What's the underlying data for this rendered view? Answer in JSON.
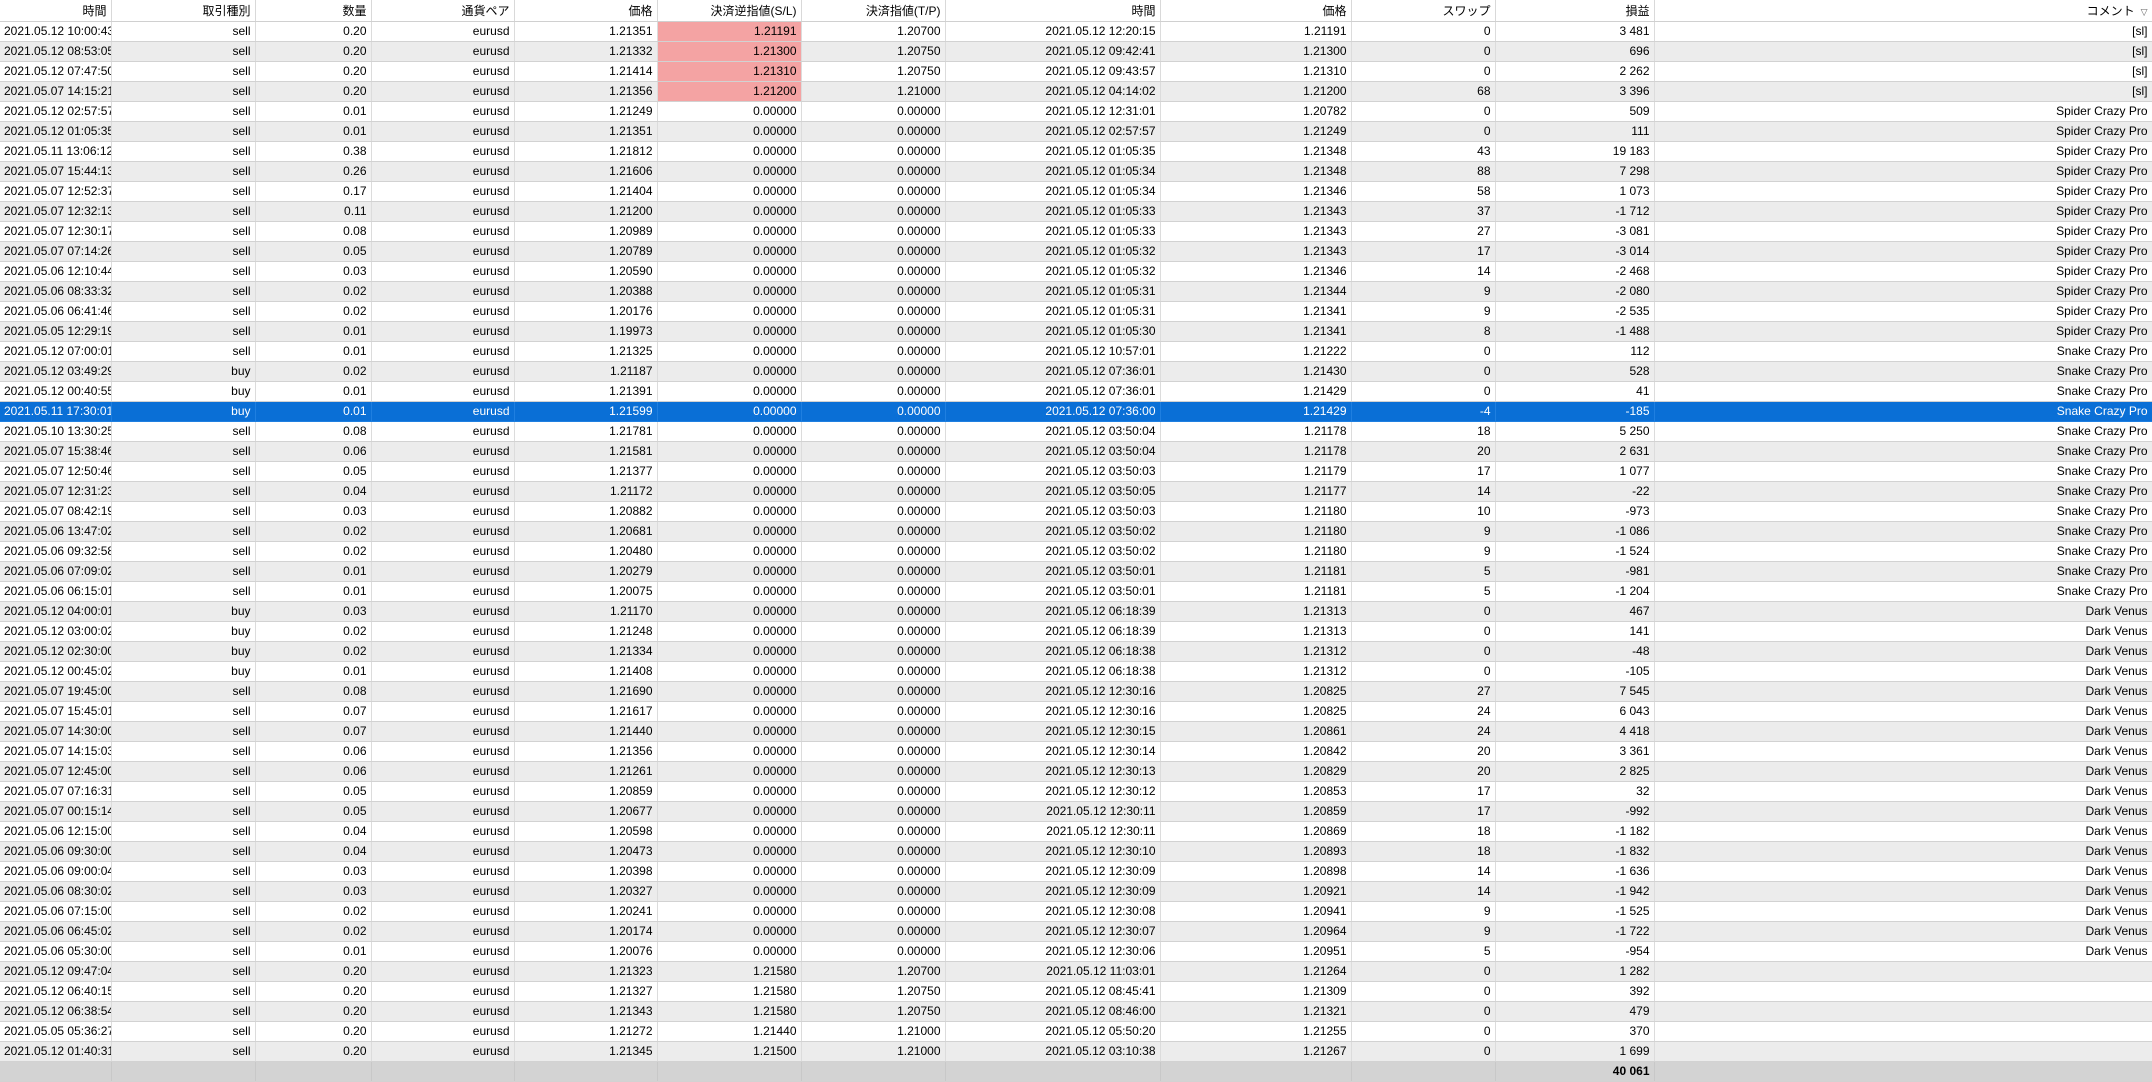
{
  "columns": [
    "時間",
    "取引種別",
    "数量",
    "通貨ペア",
    "価格",
    "決済逆指値(S/L)",
    "決済指値(T/P)",
    "時間",
    "価格",
    "スワップ",
    "損益",
    "コメント"
  ],
  "sort_icon": "▽",
  "colors": {
    "row_alt": "#ececec",
    "selected": "#0a6fd6",
    "sl_highlight": "#f4a3a3",
    "footer": "#d3d3d3"
  },
  "selected_row": 19,
  "rows": [
    [
      "2021.05.12 10:00:43",
      "sell",
      "0.20",
      "eurusd",
      "1.21351",
      "1.21191",
      "1.20700",
      "2021.05.12 12:20:15",
      "1.21191",
      "0",
      "3 481",
      "[sl]"
    ],
    [
      "2021.05.12 08:53:05",
      "sell",
      "0.20",
      "eurusd",
      "1.21332",
      "1.21300",
      "1.20750",
      "2021.05.12 09:42:41",
      "1.21300",
      "0",
      "696",
      "[sl]"
    ],
    [
      "2021.05.12 07:47:50",
      "sell",
      "0.20",
      "eurusd",
      "1.21414",
      "1.21310",
      "1.20750",
      "2021.05.12 09:43:57",
      "1.21310",
      "0",
      "2 262",
      "[sl]"
    ],
    [
      "2021.05.07 14:15:21",
      "sell",
      "0.20",
      "eurusd",
      "1.21356",
      "1.21200",
      "1.21000",
      "2021.05.12 04:14:02",
      "1.21200",
      "68",
      "3 396",
      "[sl]"
    ],
    [
      "2021.05.12 02:57:57",
      "sell",
      "0.01",
      "eurusd",
      "1.21249",
      "0.00000",
      "0.00000",
      "2021.05.12 12:31:01",
      "1.20782",
      "0",
      "509",
      "Spider Crazy Pro"
    ],
    [
      "2021.05.12 01:05:35",
      "sell",
      "0.01",
      "eurusd",
      "1.21351",
      "0.00000",
      "0.00000",
      "2021.05.12 02:57:57",
      "1.21249",
      "0",
      "111",
      "Spider Crazy Pro"
    ],
    [
      "2021.05.11 13:06:12",
      "sell",
      "0.38",
      "eurusd",
      "1.21812",
      "0.00000",
      "0.00000",
      "2021.05.12 01:05:35",
      "1.21348",
      "43",
      "19 183",
      "Spider Crazy Pro"
    ],
    [
      "2021.05.07 15:44:13",
      "sell",
      "0.26",
      "eurusd",
      "1.21606",
      "0.00000",
      "0.00000",
      "2021.05.12 01:05:34",
      "1.21348",
      "88",
      "7 298",
      "Spider Crazy Pro"
    ],
    [
      "2021.05.07 12:52:37",
      "sell",
      "0.17",
      "eurusd",
      "1.21404",
      "0.00000",
      "0.00000",
      "2021.05.12 01:05:34",
      "1.21346",
      "58",
      "1 073",
      "Spider Crazy Pro"
    ],
    [
      "2021.05.07 12:32:13",
      "sell",
      "0.11",
      "eurusd",
      "1.21200",
      "0.00000",
      "0.00000",
      "2021.05.12 01:05:33",
      "1.21343",
      "37",
      "-1 712",
      "Spider Crazy Pro"
    ],
    [
      "2021.05.07 12:30:17",
      "sell",
      "0.08",
      "eurusd",
      "1.20989",
      "0.00000",
      "0.00000",
      "2021.05.12 01:05:33",
      "1.21343",
      "27",
      "-3 081",
      "Spider Crazy Pro"
    ],
    [
      "2021.05.07 07:14:26",
      "sell",
      "0.05",
      "eurusd",
      "1.20789",
      "0.00000",
      "0.00000",
      "2021.05.12 01:05:32",
      "1.21343",
      "17",
      "-3 014",
      "Spider Crazy Pro"
    ],
    [
      "2021.05.06 12:10:44",
      "sell",
      "0.03",
      "eurusd",
      "1.20590",
      "0.00000",
      "0.00000",
      "2021.05.12 01:05:32",
      "1.21346",
      "14",
      "-2 468",
      "Spider Crazy Pro"
    ],
    [
      "2021.05.06 08:33:32",
      "sell",
      "0.02",
      "eurusd",
      "1.20388",
      "0.00000",
      "0.00000",
      "2021.05.12 01:05:31",
      "1.21344",
      "9",
      "-2 080",
      "Spider Crazy Pro"
    ],
    [
      "2021.05.06 06:41:46",
      "sell",
      "0.02",
      "eurusd",
      "1.20176",
      "0.00000",
      "0.00000",
      "2021.05.12 01:05:31",
      "1.21341",
      "9",
      "-2 535",
      "Spider Crazy Pro"
    ],
    [
      "2021.05.05 12:29:19",
      "sell",
      "0.01",
      "eurusd",
      "1.19973",
      "0.00000",
      "0.00000",
      "2021.05.12 01:05:30",
      "1.21341",
      "8",
      "-1 488",
      "Spider Crazy Pro"
    ],
    [
      "2021.05.12 07:00:01",
      "sell",
      "0.01",
      "eurusd",
      "1.21325",
      "0.00000",
      "0.00000",
      "2021.05.12 10:57:01",
      "1.21222",
      "0",
      "112",
      "Snake Crazy Pro"
    ],
    [
      "2021.05.12 03:49:29",
      "buy",
      "0.02",
      "eurusd",
      "1.21187",
      "0.00000",
      "0.00000",
      "2021.05.12 07:36:01",
      "1.21430",
      "0",
      "528",
      "Snake Crazy Pro"
    ],
    [
      "2021.05.12 00:40:55",
      "buy",
      "0.01",
      "eurusd",
      "1.21391",
      "0.00000",
      "0.00000",
      "2021.05.12 07:36:01",
      "1.21429",
      "0",
      "41",
      "Snake Crazy Pro"
    ],
    [
      "2021.05.11 17:30:01",
      "buy",
      "0.01",
      "eurusd",
      "1.21599",
      "0.00000",
      "0.00000",
      "2021.05.12 07:36:00",
      "1.21429",
      "-4",
      "-185",
      "Snake Crazy Pro"
    ],
    [
      "2021.05.10 13:30:25",
      "sell",
      "0.08",
      "eurusd",
      "1.21781",
      "0.00000",
      "0.00000",
      "2021.05.12 03:50:04",
      "1.21178",
      "18",
      "5 250",
      "Snake Crazy Pro"
    ],
    [
      "2021.05.07 15:38:46",
      "sell",
      "0.06",
      "eurusd",
      "1.21581",
      "0.00000",
      "0.00000",
      "2021.05.12 03:50:04",
      "1.21178",
      "20",
      "2 631",
      "Snake Crazy Pro"
    ],
    [
      "2021.05.07 12:50:46",
      "sell",
      "0.05",
      "eurusd",
      "1.21377",
      "0.00000",
      "0.00000",
      "2021.05.12 03:50:03",
      "1.21179",
      "17",
      "1 077",
      "Snake Crazy Pro"
    ],
    [
      "2021.05.07 12:31:23",
      "sell",
      "0.04",
      "eurusd",
      "1.21172",
      "0.00000",
      "0.00000",
      "2021.05.12 03:50:05",
      "1.21177",
      "14",
      "-22",
      "Snake Crazy Pro"
    ],
    [
      "2021.05.07 08:42:19",
      "sell",
      "0.03",
      "eurusd",
      "1.20882",
      "0.00000",
      "0.00000",
      "2021.05.12 03:50:03",
      "1.21180",
      "10",
      "-973",
      "Snake Crazy Pro"
    ],
    [
      "2021.05.06 13:47:02",
      "sell",
      "0.02",
      "eurusd",
      "1.20681",
      "0.00000",
      "0.00000",
      "2021.05.12 03:50:02",
      "1.21180",
      "9",
      "-1 086",
      "Snake Crazy Pro"
    ],
    [
      "2021.05.06 09:32:58",
      "sell",
      "0.02",
      "eurusd",
      "1.20480",
      "0.00000",
      "0.00000",
      "2021.05.12 03:50:02",
      "1.21180",
      "9",
      "-1 524",
      "Snake Crazy Pro"
    ],
    [
      "2021.05.06 07:09:02",
      "sell",
      "0.01",
      "eurusd",
      "1.20279",
      "0.00000",
      "0.00000",
      "2021.05.12 03:50:01",
      "1.21181",
      "5",
      "-981",
      "Snake Crazy Pro"
    ],
    [
      "2021.05.06 06:15:01",
      "sell",
      "0.01",
      "eurusd",
      "1.20075",
      "0.00000",
      "0.00000",
      "2021.05.12 03:50:01",
      "1.21181",
      "5",
      "-1 204",
      "Snake Crazy Pro"
    ],
    [
      "2021.05.12 04:00:01",
      "buy",
      "0.03",
      "eurusd",
      "1.21170",
      "0.00000",
      "0.00000",
      "2021.05.12 06:18:39",
      "1.21313",
      "0",
      "467",
      "Dark Venus"
    ],
    [
      "2021.05.12 03:00:02",
      "buy",
      "0.02",
      "eurusd",
      "1.21248",
      "0.00000",
      "0.00000",
      "2021.05.12 06:18:39",
      "1.21313",
      "0",
      "141",
      "Dark Venus"
    ],
    [
      "2021.05.12 02:30:00",
      "buy",
      "0.02",
      "eurusd",
      "1.21334",
      "0.00000",
      "0.00000",
      "2021.05.12 06:18:38",
      "1.21312",
      "0",
      "-48",
      "Dark Venus"
    ],
    [
      "2021.05.12 00:45:02",
      "buy",
      "0.01",
      "eurusd",
      "1.21408",
      "0.00000",
      "0.00000",
      "2021.05.12 06:18:38",
      "1.21312",
      "0",
      "-105",
      "Dark Venus"
    ],
    [
      "2021.05.07 19:45:00",
      "sell",
      "0.08",
      "eurusd",
      "1.21690",
      "0.00000",
      "0.00000",
      "2021.05.12 12:30:16",
      "1.20825",
      "27",
      "7 545",
      "Dark Venus"
    ],
    [
      "2021.05.07 15:45:01",
      "sell",
      "0.07",
      "eurusd",
      "1.21617",
      "0.00000",
      "0.00000",
      "2021.05.12 12:30:16",
      "1.20825",
      "24",
      "6 043",
      "Dark Venus"
    ],
    [
      "2021.05.07 14:30:00",
      "sell",
      "0.07",
      "eurusd",
      "1.21440",
      "0.00000",
      "0.00000",
      "2021.05.12 12:30:15",
      "1.20861",
      "24",
      "4 418",
      "Dark Venus"
    ],
    [
      "2021.05.07 14:15:03",
      "sell",
      "0.06",
      "eurusd",
      "1.21356",
      "0.00000",
      "0.00000",
      "2021.05.12 12:30:14",
      "1.20842",
      "20",
      "3 361",
      "Dark Venus"
    ],
    [
      "2021.05.07 12:45:00",
      "sell",
      "0.06",
      "eurusd",
      "1.21261",
      "0.00000",
      "0.00000",
      "2021.05.12 12:30:13",
      "1.20829",
      "20",
      "2 825",
      "Dark Venus"
    ],
    [
      "2021.05.07 07:16:31",
      "sell",
      "0.05",
      "eurusd",
      "1.20859",
      "0.00000",
      "0.00000",
      "2021.05.12 12:30:12",
      "1.20853",
      "17",
      "32",
      "Dark Venus"
    ],
    [
      "2021.05.07 00:15:14",
      "sell",
      "0.05",
      "eurusd",
      "1.20677",
      "0.00000",
      "0.00000",
      "2021.05.12 12:30:11",
      "1.20859",
      "17",
      "-992",
      "Dark Venus"
    ],
    [
      "2021.05.06 12:15:00",
      "sell",
      "0.04",
      "eurusd",
      "1.20598",
      "0.00000",
      "0.00000",
      "2021.05.12 12:30:11",
      "1.20869",
      "18",
      "-1 182",
      "Dark Venus"
    ],
    [
      "2021.05.06 09:30:00",
      "sell",
      "0.04",
      "eurusd",
      "1.20473",
      "0.00000",
      "0.00000",
      "2021.05.12 12:30:10",
      "1.20893",
      "18",
      "-1 832",
      "Dark Venus"
    ],
    [
      "2021.05.06 09:00:04",
      "sell",
      "0.03",
      "eurusd",
      "1.20398",
      "0.00000",
      "0.00000",
      "2021.05.12 12:30:09",
      "1.20898",
      "14",
      "-1 636",
      "Dark Venus"
    ],
    [
      "2021.05.06 08:30:02",
      "sell",
      "0.03",
      "eurusd",
      "1.20327",
      "0.00000",
      "0.00000",
      "2021.05.12 12:30:09",
      "1.20921",
      "14",
      "-1 942",
      "Dark Venus"
    ],
    [
      "2021.05.06 07:15:00",
      "sell",
      "0.02",
      "eurusd",
      "1.20241",
      "0.00000",
      "0.00000",
      "2021.05.12 12:30:08",
      "1.20941",
      "9",
      "-1 525",
      "Dark Venus"
    ],
    [
      "2021.05.06 06:45:02",
      "sell",
      "0.02",
      "eurusd",
      "1.20174",
      "0.00000",
      "0.00000",
      "2021.05.12 12:30:07",
      "1.20964",
      "9",
      "-1 722",
      "Dark Venus"
    ],
    [
      "2021.05.06 05:30:00",
      "sell",
      "0.01",
      "eurusd",
      "1.20076",
      "0.00000",
      "0.00000",
      "2021.05.12 12:30:06",
      "1.20951",
      "5",
      "-954",
      "Dark Venus"
    ],
    [
      "2021.05.12 09:47:04",
      "sell",
      "0.20",
      "eurusd",
      "1.21323",
      "1.21580",
      "1.20700",
      "2021.05.12 11:03:01",
      "1.21264",
      "0",
      "1 282",
      ""
    ],
    [
      "2021.05.12 06:40:15",
      "sell",
      "0.20",
      "eurusd",
      "1.21327",
      "1.21580",
      "1.20750",
      "2021.05.12 08:45:41",
      "1.21309",
      "0",
      "392",
      ""
    ],
    [
      "2021.05.12 06:38:54",
      "sell",
      "0.20",
      "eurusd",
      "1.21343",
      "1.21580",
      "1.20750",
      "2021.05.12 08:46:00",
      "1.21321",
      "0",
      "479",
      ""
    ],
    [
      "2021.05.05 05:36:27",
      "sell",
      "0.20",
      "eurusd",
      "1.21272",
      "1.21440",
      "1.21000",
      "2021.05.12 05:50:20",
      "1.21255",
      "0",
      "370",
      ""
    ],
    [
      "2021.05.12 01:40:31",
      "sell",
      "0.20",
      "eurusd",
      "1.21345",
      "1.21500",
      "1.21000",
      "2021.05.12 03:10:38",
      "1.21267",
      "0",
      "1 699",
      ""
    ]
  ],
  "sl_highlight_rows": [
    0,
    1,
    2,
    3
  ],
  "total_profit": "40 061"
}
